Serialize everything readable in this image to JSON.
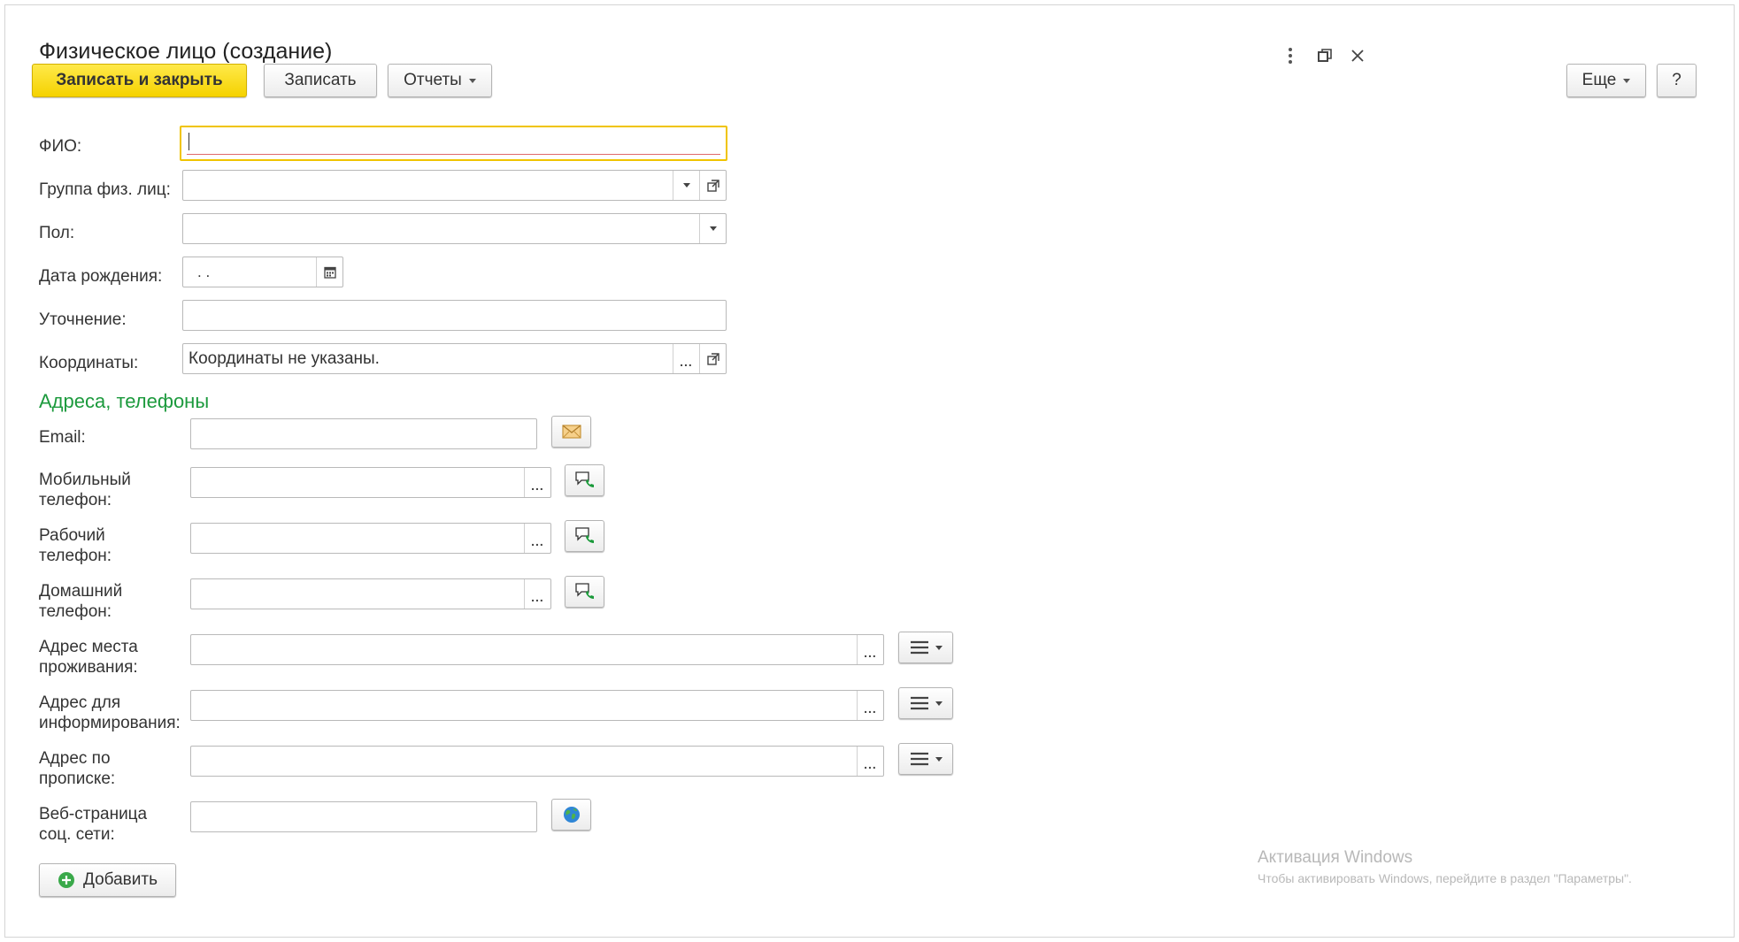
{
  "window": {
    "title": "Физическое лицо (создание)"
  },
  "toolbar": {
    "save_close": "Записать и закрыть",
    "save": "Записать",
    "reports": "Отчеты",
    "more": "Еще",
    "help": "?"
  },
  "form": {
    "fio_label": "ФИО:",
    "fio_value": "",
    "group_label": "Группа физ. лиц:",
    "group_value": "",
    "gender_label": "Пол:",
    "gender_value": "",
    "birthdate_label": "Дата рождения:",
    "birthdate_value": " .  .",
    "clarification_label": "Уточнение:",
    "clarification_value": "",
    "coords_label": "Координаты:",
    "coords_value": "Координаты не указаны."
  },
  "contacts": {
    "section_title": "Адреса, телефоны",
    "email_label": "Email:",
    "mobile_label_1": "Мобильный",
    "mobile_label_2": "телефон:",
    "work_label_1": "Рабочий",
    "work_label_2": "телефон:",
    "home_label_1": "Домашний",
    "home_label_2": "телефон:",
    "residence_label_1": "Адрес места",
    "residence_label_2": "проживания:",
    "info_label_1": "Адрес для",
    "info_label_2": "информирования:",
    "registration_label_1": "Адрес по",
    "registration_label_2": "прописке:",
    "social_label_1": "Веб-страница",
    "social_label_2": "соц. сети:",
    "add_button": "Добавить"
  },
  "watermark": {
    "title": "Активация Windows",
    "text": "Чтобы активировать Windows, перейдите в раздел \"Параметры\"."
  },
  "icons": {
    "kebab": "kebab-menu-icon",
    "restore": "restore-window-icon",
    "close": "close-icon",
    "calendar": "calendar-icon",
    "open": "open-form-icon",
    "mail": "mail-icon",
    "phone": "phone-call-icon",
    "menu": "list-menu-icon",
    "globe": "globe-icon",
    "add": "plus-circle-icon"
  },
  "colors": {
    "primary_button": "#f5d200",
    "section_title": "#1c9a3d",
    "focus_border": "#f0c400"
  }
}
